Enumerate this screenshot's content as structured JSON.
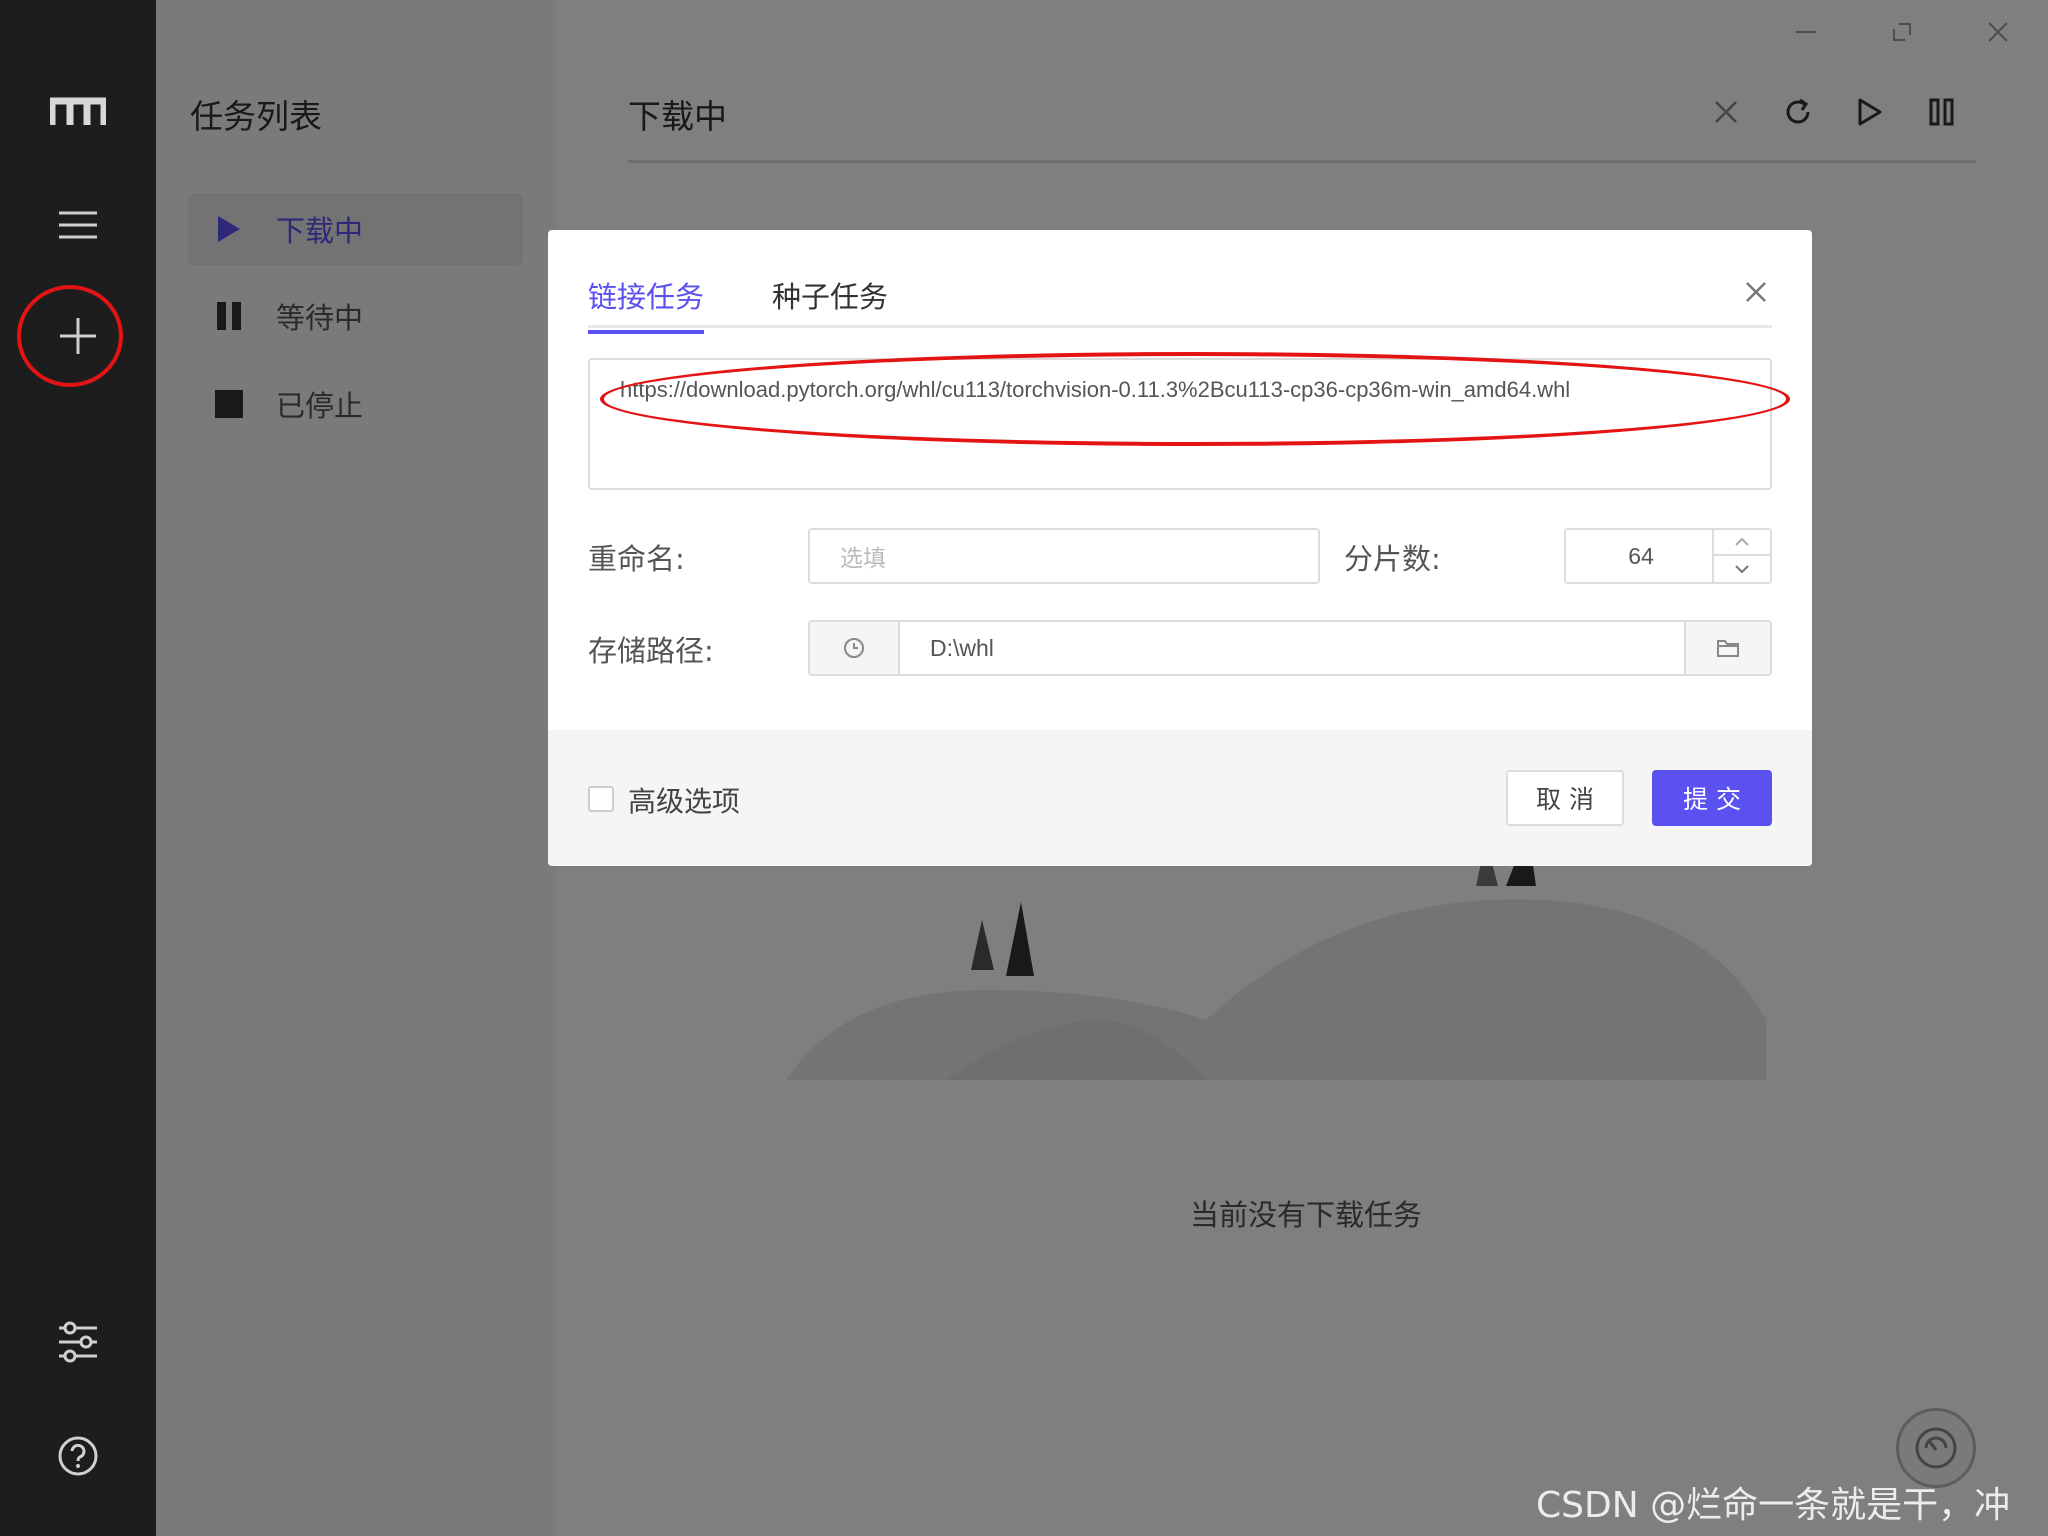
{
  "app": {
    "logo": "logo-icon"
  },
  "rail": {
    "items": [
      "menu-icon",
      "add-icon",
      "settings-sliders-icon",
      "help-icon"
    ]
  },
  "tasks": {
    "title": "任务列表",
    "items": [
      {
        "label": "下载中",
        "icon": "play-icon"
      },
      {
        "label": "等待中",
        "icon": "pause-icon"
      },
      {
        "label": "已停止",
        "icon": "stop-icon"
      }
    ]
  },
  "main": {
    "title": "下载中",
    "empty_text": "当前没有下载任务"
  },
  "dialog": {
    "tabs": [
      "链接任务",
      "种子任务"
    ],
    "url": "https://download.pytorch.org/whl/cu113/torchvision-0.11.3%2Bcu113-cp36-cp36m-win_amd64.whl",
    "rename_label": "重命名:",
    "rename_placeholder": "选填",
    "slices_label": "分片数:",
    "slices_value": "64",
    "path_label": "存储路径:",
    "path_value": "D:\\whl",
    "advanced_label": "高级选项",
    "cancel_label": "取 消",
    "submit_label": "提 交"
  },
  "watermark": "CSDN @烂命一条就是干，冲",
  "colors": {
    "accent": "#5b50f0",
    "highlight": "#e41414",
    "rail": "#1d1d1d"
  }
}
